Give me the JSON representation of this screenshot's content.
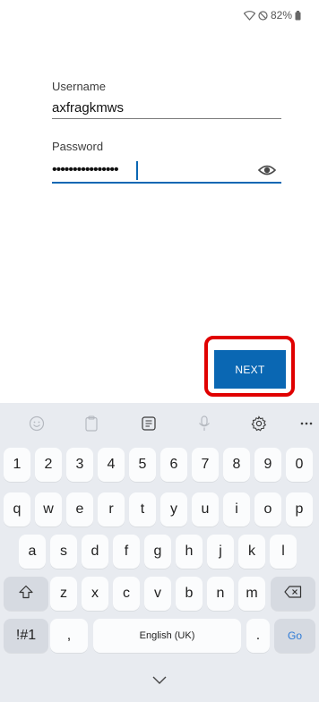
{
  "status_bar": {
    "battery_text": "82%"
  },
  "form": {
    "username_label": "Username",
    "username_value": "axfragkmws",
    "password_label": "Password",
    "password_value": "••••••••••••••••"
  },
  "next_button": {
    "label": "NEXT"
  },
  "keyboard": {
    "row_numbers": [
      "1",
      "2",
      "3",
      "4",
      "5",
      "6",
      "7",
      "8",
      "9",
      "0"
    ],
    "row_top": [
      "q",
      "w",
      "e",
      "r",
      "t",
      "y",
      "u",
      "i",
      "o",
      "p"
    ],
    "row_middle": [
      "a",
      "s",
      "d",
      "f",
      "g",
      "h",
      "j",
      "k",
      "l"
    ],
    "row_bottom": [
      "z",
      "x",
      "c",
      "v",
      "b",
      "n",
      "m"
    ],
    "symbols_label": "!#1",
    "comma_label": ",",
    "space_label": "English (UK)",
    "period_label": ".",
    "go_label": "Go",
    "toolbar_icons": [
      "emoji-icon",
      "clipboard-icon",
      "keyboard-mode-icon",
      "mic-icon",
      "settings-icon",
      "more-icon"
    ]
  },
  "colors": {
    "accent": "#0a67b3",
    "highlight": "#e00000",
    "keyboard_bg": "#e8ebf0"
  }
}
